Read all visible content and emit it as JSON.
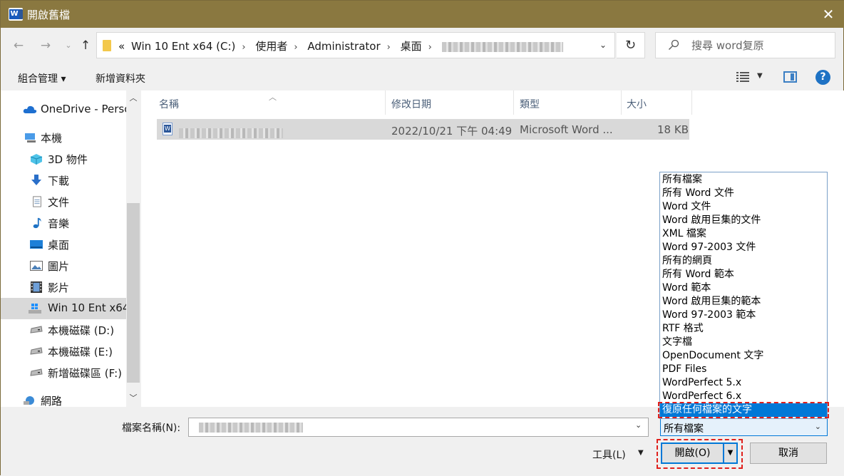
{
  "window": {
    "title": "開啟舊檔",
    "app_icon_letter": "W"
  },
  "address": {
    "crumbs": [
      "Win 10 Ent x64 (C:)",
      "使用者",
      "Administrator",
      "桌面"
    ],
    "overflow_glyph": "«",
    "separator": "›"
  },
  "search": {
    "placeholder": "搜尋 word复原"
  },
  "toolbar": {
    "organize": "組合管理 ▾",
    "new_folder": "新增資料夾",
    "help": "?"
  },
  "nav": {
    "items": [
      {
        "label": "OneDrive - Perso",
        "icon": "onedrive-icon"
      },
      {
        "label": "本機",
        "icon": "computer-icon"
      },
      {
        "label": "3D 物件",
        "icon": "3d-objects-icon"
      },
      {
        "label": "下載",
        "icon": "download-icon"
      },
      {
        "label": "文件",
        "icon": "document-icon"
      },
      {
        "label": "音樂",
        "icon": "music-icon"
      },
      {
        "label": "桌面",
        "icon": "desktop-icon"
      },
      {
        "label": "圖片",
        "icon": "pictures-icon"
      },
      {
        "label": "影片",
        "icon": "video-icon"
      },
      {
        "label": "Win 10 Ent x64",
        "icon": "windows-drive-icon",
        "selected": true
      },
      {
        "label": "本機磁碟 (D:)",
        "icon": "drive-icon"
      },
      {
        "label": "本機磁碟 (E:)",
        "icon": "drive-icon"
      },
      {
        "label": "新增磁碟區 (F:)",
        "icon": "drive-icon"
      },
      {
        "label": "網路",
        "icon": "network-icon"
      }
    ]
  },
  "columns": {
    "name": "名稱",
    "modified": "修改日期",
    "type": "類型",
    "size": "大小"
  },
  "files": [
    {
      "modified": "2022/10/21 下午 04:49",
      "type": "Microsoft Word ...",
      "size": "18 KB"
    }
  ],
  "filetype_list": {
    "items": [
      "所有檔案",
      "所有 Word 文件",
      "Word 文件",
      "Word 啟用巨集的文件",
      "XML 檔案",
      "Word 97-2003 文件",
      "所有的網頁",
      "所有 Word 範本",
      "Word 範本",
      "Word 啟用巨集的範本",
      "Word 97-2003 範本",
      "RTF 格式",
      "文字檔",
      "OpenDocument 文字",
      "PDF Files",
      "WordPerfect 5.x",
      "WordPerfect 6.x",
      "復原任何檔案的文字"
    ],
    "selected_index": 17
  },
  "bottom": {
    "filename_label": "檔案名稱(N):",
    "filetype_value": "所有檔案",
    "tools": "工具(L)",
    "open": "開啟(O)",
    "cancel": "取消"
  },
  "colors": {
    "titlebar": "#8a7840",
    "accent": "#0078d7",
    "highlight": "#e0201c"
  }
}
